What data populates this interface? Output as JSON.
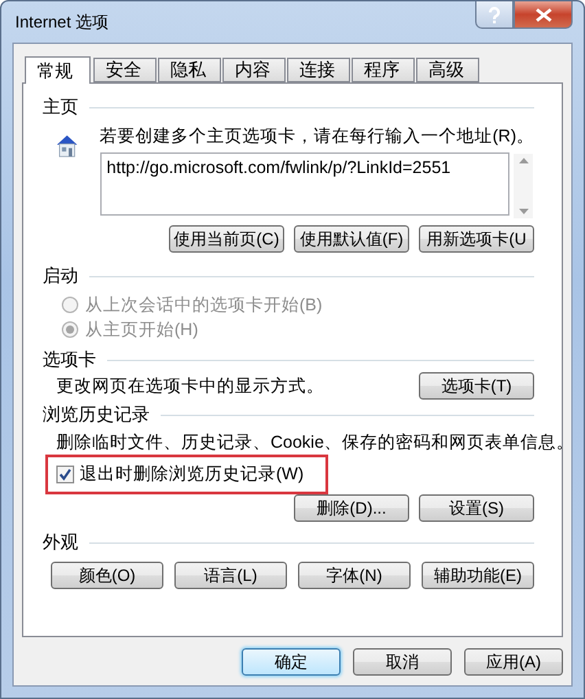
{
  "window": {
    "title": "Internet 选项"
  },
  "tabs": [
    {
      "label": "常规",
      "selected": true
    },
    {
      "label": "安全",
      "selected": false
    },
    {
      "label": "隐私",
      "selected": false
    },
    {
      "label": "内容",
      "selected": false
    },
    {
      "label": "连接",
      "selected": false
    },
    {
      "label": "程序",
      "selected": false
    },
    {
      "label": "高级",
      "selected": false
    }
  ],
  "home_page": {
    "heading": "主页",
    "instruction": "若要创建多个主页选项卡，请在每行输入一个地址(R)。",
    "urls": "http://go.microsoft.com/fwlink/p/?LinkId=2551",
    "buttons": [
      "使用当前页(C)",
      "使用默认值(F)",
      "用新选项卡(U"
    ]
  },
  "startup": {
    "heading": "启动",
    "options": [
      {
        "label": "从上次会话中的选项卡开始(B)",
        "selected": false,
        "disabled": true
      },
      {
        "label": "从主页开始(H)",
        "selected": true,
        "disabled": true
      }
    ]
  },
  "tabs_section": {
    "heading": "选项卡",
    "description": "更改网页在选项卡中的显示方式。",
    "button": "选项卡(T)"
  },
  "history": {
    "heading": "浏览历史记录",
    "description": "删除临时文件、历史记录、Cookie、保存的密码和网页表单信息。",
    "checkbox": {
      "label": "退出时删除浏览历史记录(W)",
      "checked": true,
      "highlighted": true
    },
    "buttons": [
      "删除(D)...",
      "设置(S)"
    ]
  },
  "appearance": {
    "heading": "外观",
    "buttons": [
      "颜色(O)",
      "语言(L)",
      "字体(N)",
      "辅助功能(E)"
    ]
  },
  "footer_buttons": [
    {
      "label": "确定",
      "focused": true
    },
    {
      "label": "取消",
      "focused": false
    },
    {
      "label": "应用(A)",
      "focused": false
    }
  ]
}
